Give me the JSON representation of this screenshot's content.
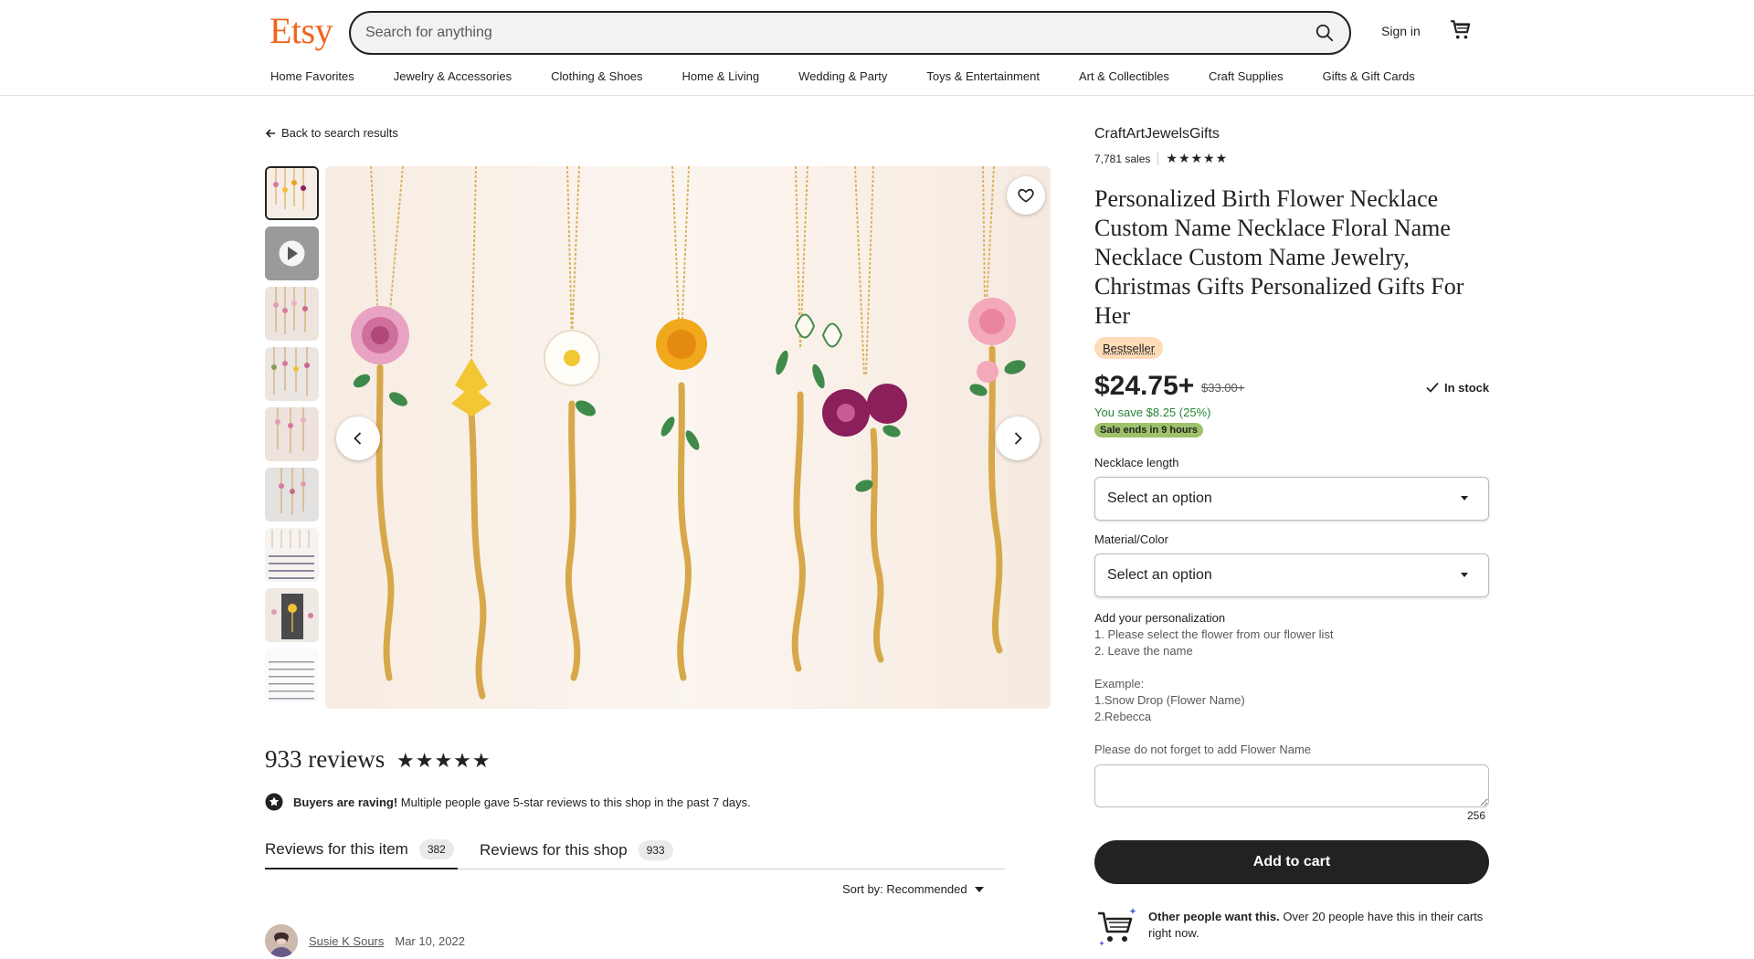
{
  "header": {
    "logo": "Etsy",
    "search_placeholder": "Search for anything",
    "signin_label": "Sign in",
    "categories": [
      "Home Favorites",
      "Jewelry & Accessories",
      "Clothing & Shoes",
      "Home & Living",
      "Wedding & Party",
      "Toys & Entertainment",
      "Art & Collectibles",
      "Craft Supplies",
      "Gifts & Gift Cards"
    ]
  },
  "back_label": "Back to search results",
  "gallery": {
    "thumb_count": 9,
    "accent": "#f1641e"
  },
  "listing": {
    "shop_name": "CraftArtJewelsGifts",
    "sales": "7,781 sales",
    "shop_stars": "★★★★★",
    "title": "Personalized Birth Flower Necklace Custom Name Necklace Floral Name Necklace Custom Name Jewelry, Christmas Gifts Personalized Gifts For Her",
    "badge": "Bestseller",
    "price": "$24.75+",
    "old_price": "$33.00+",
    "stock": "In stock",
    "savings": "You save $8.25 (25%)",
    "sale_ends": "Sale ends in 9 hours",
    "necklace_length_label": "Necklace length",
    "necklace_length_value": "Select an option",
    "material_label": "Material/Color",
    "material_value": "Select an option",
    "personalization_title": "Add your personalization",
    "personalization_lines": [
      "1. Please select the flower from our flower list",
      "2. Leave the name",
      "",
      "Example:",
      "1.Snow Drop (Flower Name)",
      "2.Rebecca",
      "",
      "Please do not forget to add Flower Name"
    ],
    "char_count": "256",
    "add_to_cart": "Add to cart",
    "other_bold": "Other people want this.",
    "other_rest": " Over 20 people have this in their carts right now."
  },
  "reviews": {
    "count_label": "933 reviews",
    "stars": "★★★★★",
    "raving_bold": "Buyers are raving!",
    "raving_rest": " Multiple people gave 5-star reviews to this shop in the past 7 days.",
    "tab_item_label": "Reviews for this item",
    "tab_item_count": "382",
    "tab_shop_label": "Reviews for this shop",
    "tab_shop_count": "933",
    "sort_label": "Sort by: Recommended",
    "first_reviewer": "Susie K Sours",
    "first_date": "Mar 10, 2022"
  },
  "colors": {
    "brand": "#f1641e",
    "save_green": "#258635",
    "sale_badge": "#9ec26a",
    "bestseller_badge": "#fddcb7"
  }
}
